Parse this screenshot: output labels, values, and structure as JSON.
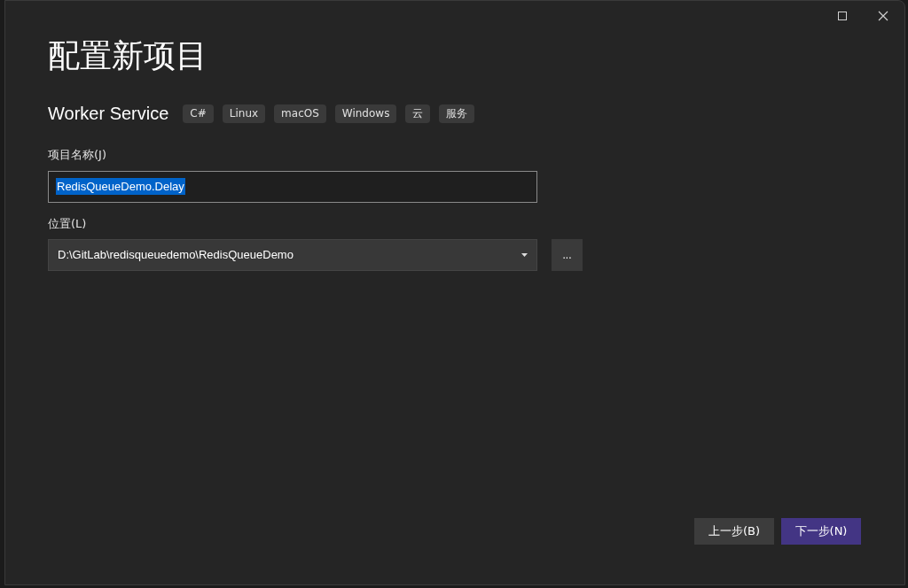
{
  "dialog": {
    "title": "配置新项目"
  },
  "template": {
    "name": "Worker Service",
    "tags": [
      "C#",
      "Linux",
      "macOS",
      "Windows",
      "云",
      "服务"
    ]
  },
  "project_name": {
    "label": "项目名称(J)",
    "value": "RedisQueueDemo.Delay",
    "text_selected": true
  },
  "location": {
    "label": "位置(L)",
    "value": "D:\\GitLab\\redisqueuedemo\\RedisQueueDemo",
    "browse": "..."
  },
  "buttons": [
    {
      "label": "上一步(B)",
      "kind": "secondary"
    },
    {
      "label": "下一步(N)",
      "kind": "primary"
    }
  ]
}
